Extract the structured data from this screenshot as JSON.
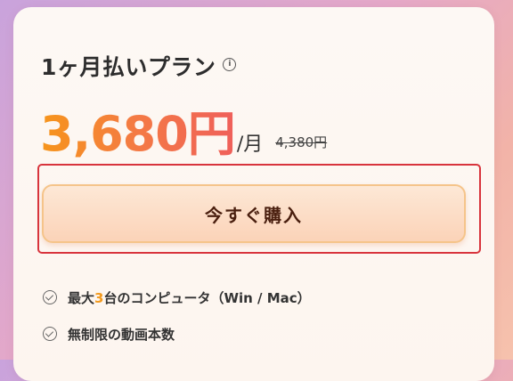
{
  "plan": {
    "title": "1ヶ月払いプラン",
    "info_icon": "i",
    "price": "3,680円",
    "per": "/月",
    "old_price": "4,380円"
  },
  "buy_button": {
    "label": "今すぐ購入"
  },
  "features": [
    {
      "prefix": "最大",
      "highlight": "3",
      "suffix": "台のコンピュータ（Win / Mac）"
    },
    {
      "text": "無制限の動画本数"
    }
  ],
  "colors": {
    "accent_orange": "#f6951b",
    "accent_red": "#ef5f5a",
    "highlight_border": "#d8343d",
    "button_bg": "#fbd3b8"
  }
}
